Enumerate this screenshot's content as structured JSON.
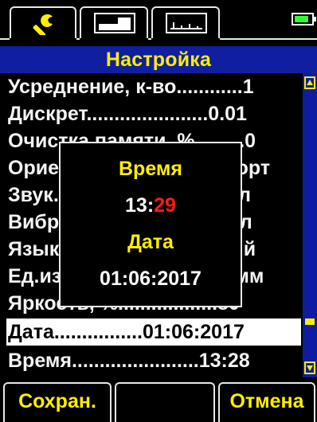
{
  "tabs": [
    {
      "icon": "wrench-icon",
      "active": true
    },
    {
      "icon": "graph-display-icon",
      "active": false
    },
    {
      "icon": "histogram-display-icon",
      "active": false
    }
  ],
  "battery": {
    "icon": "battery-icon",
    "level": 0.75,
    "color": "#33ff33"
  },
  "header": {
    "title": "Настройка"
  },
  "menu": {
    "rows": [
      {
        "label": "Усреднение, к-во............1"
      },
      {
        "label": "Дискрет......................0.01"
      },
      {
        "label": "Очистка памяти, %.........0"
      },
      {
        "label": "Ориентация.................Порт"
      },
      {
        "label": "Звук.............................Вкл"
      },
      {
        "label": "Вибро..........................Вкл"
      },
      {
        "label": "Язык.....................Русский"
      },
      {
        "label": "Ед.измерения................мм"
      },
      {
        "label": "Яркость, %..................80"
      },
      {
        "label": "Дата................01:06:2017"
      },
      {
        "label": "Время.......................13:28"
      }
    ],
    "selected_index": 9
  },
  "scrollbar": {
    "position": 0.85
  },
  "popup": {
    "time_label": "Время",
    "time_hours": "13",
    "time_sep": ":",
    "time_minutes": "29",
    "date_label": "Дата",
    "date_value": "01:06:2017"
  },
  "softkeys": {
    "save": "Сохран.",
    "middle": "",
    "cancel": "Отмена"
  },
  "colors": {
    "accent": "#ffee00",
    "header_bg": "#0f1fa0",
    "highlight": "#ff1a1a"
  }
}
